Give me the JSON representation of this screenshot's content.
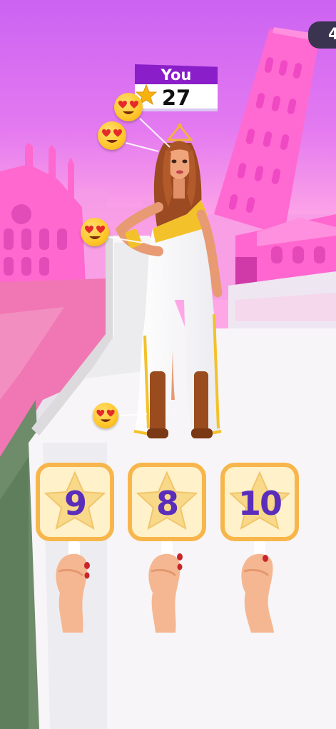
{
  "hud": {
    "counter": "4"
  },
  "player": {
    "label": "You",
    "score": "27"
  },
  "judges": [
    {
      "score": "9"
    },
    {
      "score": "8"
    },
    {
      "score": "10"
    }
  ],
  "colors": {
    "sky": "#d66cf3",
    "buildings": "#ff7fd8",
    "tower": "#ff5fcf",
    "runway": "#f6f4f6",
    "card_border": "#f7b64b",
    "card_fill": "#fff1c9",
    "number": "#5a2dbb",
    "label_purple": "#8a1ec8"
  }
}
